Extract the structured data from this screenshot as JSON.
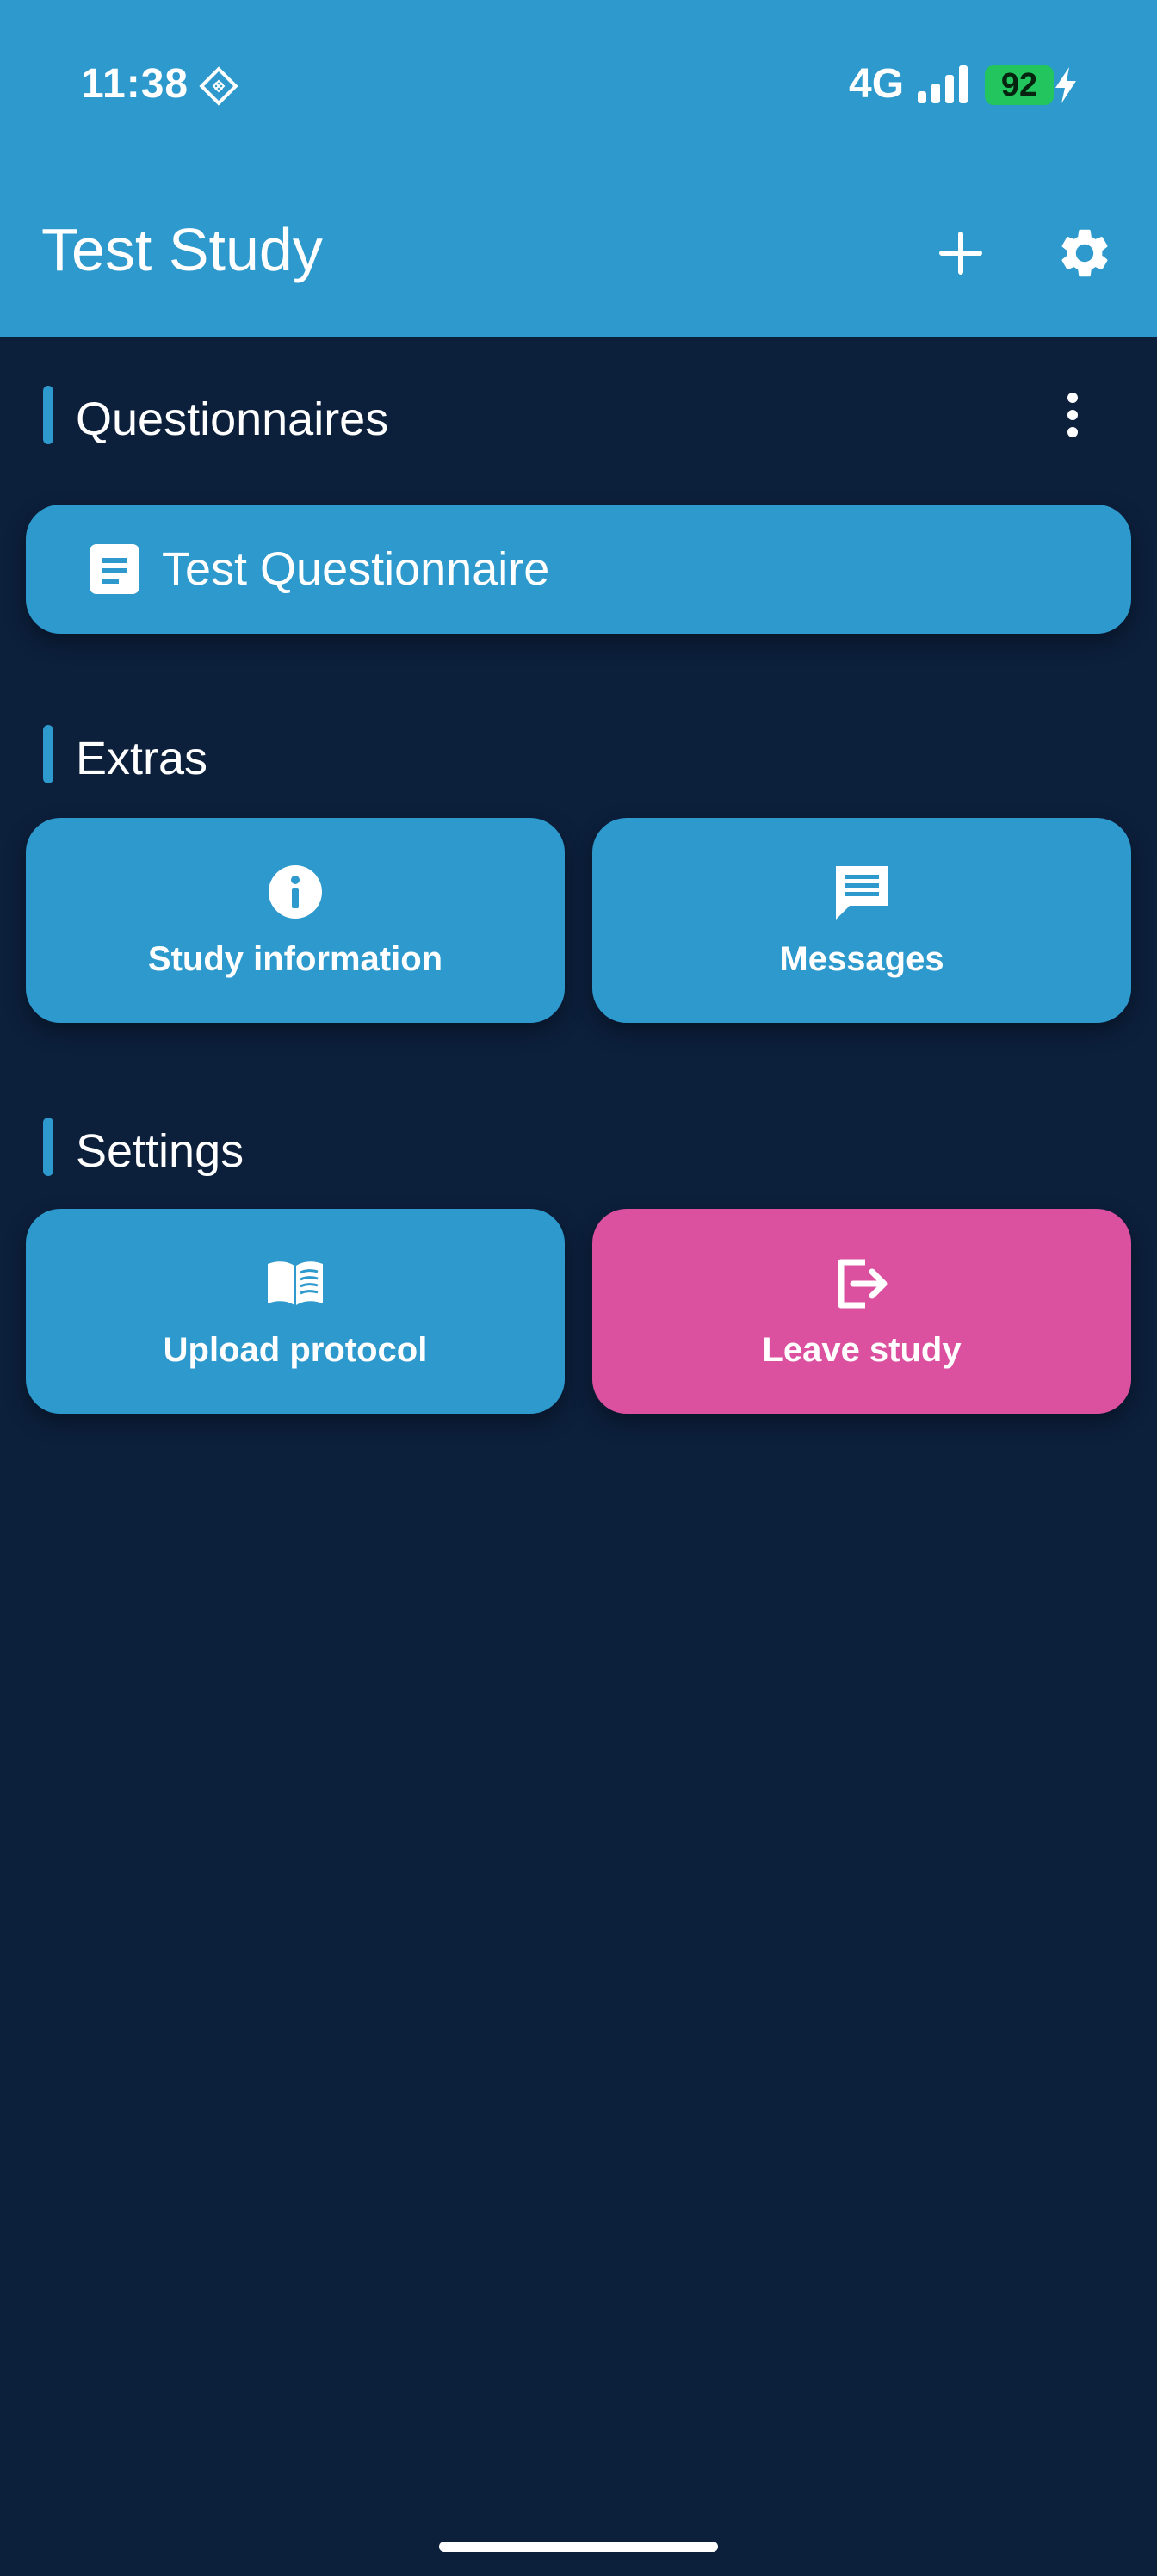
{
  "status_bar": {
    "time": "11:38",
    "network": "4G",
    "battery": "92",
    "sim_icon": "sim-diamond-icon",
    "signal_icon": "signal-bars-icon",
    "charging_icon": "bolt-icon"
  },
  "app_bar": {
    "title": "Test Study",
    "add_icon": "plus-icon",
    "settings_icon": "gear-icon"
  },
  "sections": {
    "questionnaires": {
      "title": "Questionnaires",
      "more_icon": "more-vertical-icon",
      "items": [
        {
          "label": "Test Questionnaire",
          "icon": "document-icon"
        }
      ]
    },
    "extras": {
      "title": "Extras",
      "tiles": [
        {
          "label": "Study information",
          "icon": "info-icon"
        },
        {
          "label": "Messages",
          "icon": "message-icon"
        }
      ]
    },
    "settings": {
      "title": "Settings",
      "tiles": [
        {
          "label": "Upload protocol",
          "icon": "book-icon"
        },
        {
          "label": "Leave study",
          "icon": "logout-icon"
        }
      ]
    }
  },
  "colors": {
    "primary": "#2d99cc",
    "background": "#0c1f3b",
    "danger": "#dc50a0",
    "battery": "#22c55e"
  }
}
